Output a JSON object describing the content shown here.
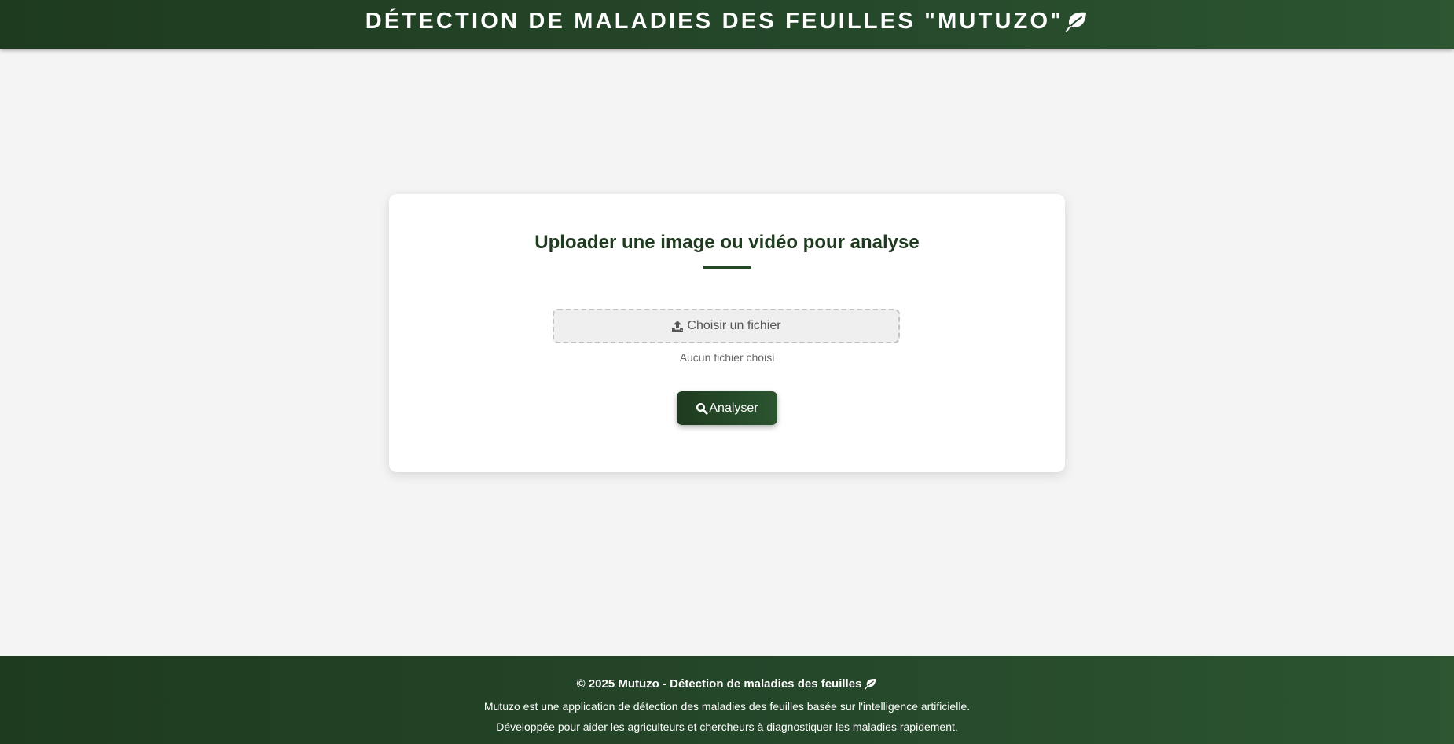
{
  "header": {
    "title": "DÉTECTION DE MALADIES DES FEUILLES \"MUTUZO\"",
    "icon": "leaf-icon"
  },
  "upload_card": {
    "title": "Uploader une image ou vidéo pour analyse",
    "file_button_label": "Choisir un fichier",
    "file_button_icon": "upload-icon",
    "file_status": "Aucun fichier choisi",
    "analyze_label": "Analyser",
    "analyze_icon": "search-icon"
  },
  "footer": {
    "copyright": "© 2025 Mutuzo - Détection de maladies des feuilles",
    "line1": "Mutuzo est une application de détection des maladies des feuilles basée sur l'intelligence artificielle.",
    "line2": "Développée pour aider les agriculteurs et chercheurs à diagnostiquer les maladies rapidement."
  },
  "colors": {
    "primary": "#1e3b1f",
    "primary_light": "#2c5530",
    "background": "#f4f4f4",
    "card": "#ffffff"
  }
}
